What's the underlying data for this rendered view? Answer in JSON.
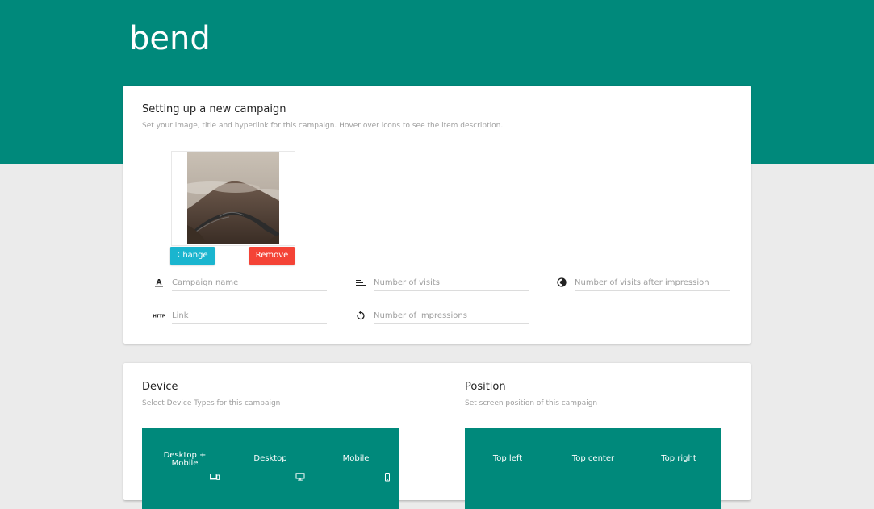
{
  "brand": {
    "logo": "bend",
    "color": "#00897b"
  },
  "campaign_card": {
    "title": "Setting up a new campaign",
    "subtitle": "Set your image, title and hyperlink for this campaign. Hover over icons to see the item description.",
    "change_label": "Change",
    "remove_label": "Remove",
    "fields": {
      "campaign_name": {
        "placeholder": "Campaign name",
        "icon": "text-format-icon"
      },
      "visits": {
        "placeholder": "Number of visits",
        "icon": "sort-lines-icon"
      },
      "visits_after": {
        "placeholder": "Number of visits after impression",
        "icon": "contrast-icon"
      },
      "link": {
        "placeholder": "Link",
        "icon": "http-icon"
      },
      "impressions": {
        "placeholder": "Number of impressions",
        "icon": "replay-icon"
      }
    }
  },
  "device_card": {
    "title": "Device",
    "subtitle": "Select Device Types for this campaign",
    "options": {
      "desktop_mobile": {
        "line1": "Desktop +",
        "line2": "Mobile",
        "icon": "devices-icon"
      },
      "desktop": {
        "label": "Desktop",
        "icon": "desktop-icon"
      },
      "mobile": {
        "label": "Mobile",
        "icon": "phone-icon"
      }
    }
  },
  "position_card": {
    "title": "Position",
    "subtitle": "Set screen position of this campaign",
    "options": {
      "top_left": "Top left",
      "top_center": "Top center",
      "top_right": "Top right"
    }
  },
  "colors": {
    "teal": "#00897b",
    "change_button": "#1ab5cf",
    "remove_button": "#f44336",
    "background": "#ebebeb"
  }
}
